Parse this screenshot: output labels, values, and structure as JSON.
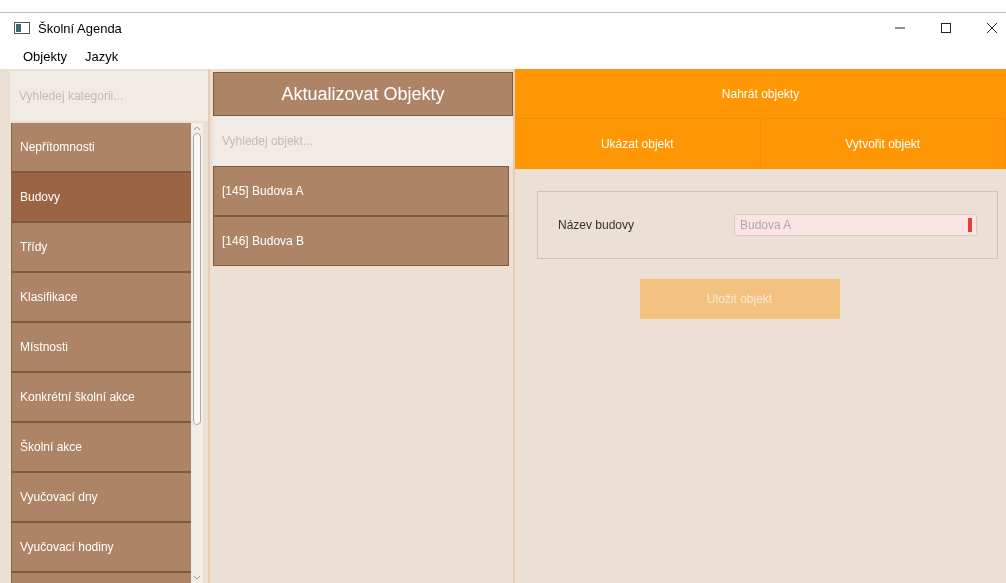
{
  "window": {
    "title": "Školní Agenda"
  },
  "menu": [
    "Objekty",
    "Jazyk"
  ],
  "categories": {
    "search": {
      "placeholder": "Vyhledej kategorii..."
    },
    "items": [
      {
        "label": "Nepřítomnosti",
        "selected": false
      },
      {
        "label": "Budovy",
        "selected": true
      },
      {
        "label": "Třídy",
        "selected": false
      },
      {
        "label": "Klasifikace",
        "selected": false
      },
      {
        "label": "Místnosti",
        "selected": false
      },
      {
        "label": "Konkrétní školní akce",
        "selected": false
      },
      {
        "label": "Školní akce",
        "selected": false
      },
      {
        "label": "Vyučovací dny",
        "selected": false
      },
      {
        "label": "Vyučovací hodiny",
        "selected": false
      }
    ]
  },
  "objects": {
    "header": "Aktualizovat Objekty",
    "search": {
      "placeholder": "Vyhledej objekt..."
    },
    "items": [
      {
        "label": "[145] Budova A",
        "selected": false
      },
      {
        "label": "[146] Budova B",
        "selected": false
      }
    ]
  },
  "actions": {
    "upload": "Nahrát objekty",
    "tabs": [
      {
        "label": "Ukázat objekt",
        "selected": false
      },
      {
        "label": "Vytvořit objekt",
        "selected": false
      }
    ]
  },
  "form": {
    "fields": [
      {
        "label": "Název budovy",
        "placeholder": "Budova A",
        "invalid": true
      }
    ],
    "save": {
      "label": "Uložit objekt",
      "disabled": true
    }
  }
}
